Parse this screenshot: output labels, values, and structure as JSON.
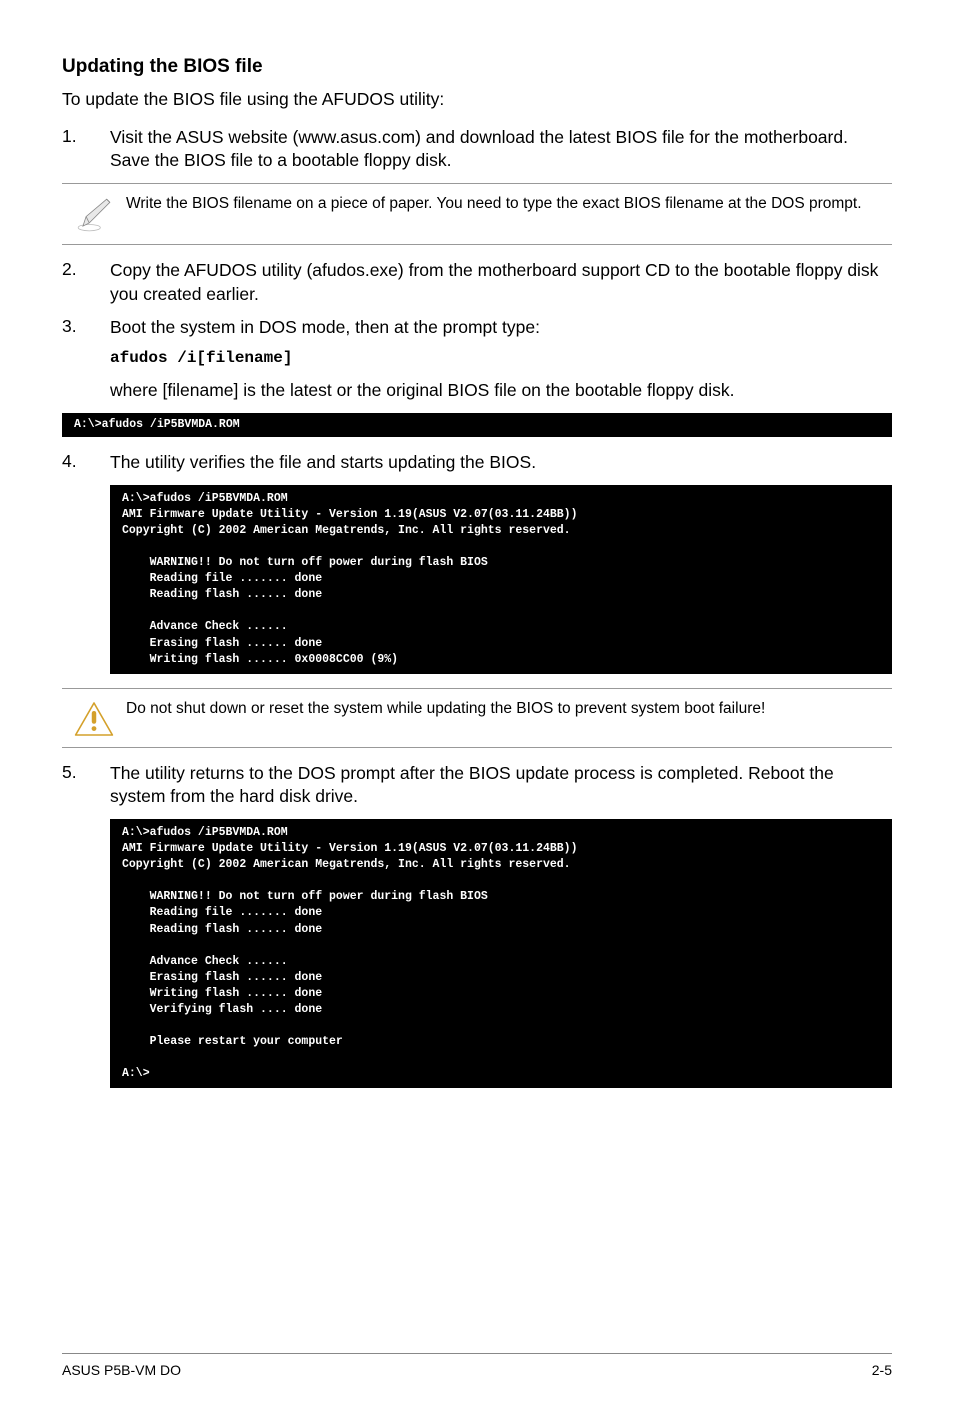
{
  "heading": "Updating the BIOS file",
  "intro": "To update the BIOS file using the AFUDOS utility:",
  "steps": {
    "s1": {
      "num": "1.",
      "text": "Visit the ASUS website (www.asus.com) and download the latest BIOS file for the motherboard. Save the BIOS file to a bootable floppy disk."
    },
    "s2": {
      "num": "2.",
      "text": "Copy the AFUDOS utility (afudos.exe) from the motherboard support CD to the bootable floppy disk you created earlier."
    },
    "s3": {
      "num": "3.",
      "text": "Boot the system in DOS mode, then at the prompt type:",
      "code": "afudos /i[filename]"
    },
    "s3b": "where [filename] is the latest or the original BIOS file on the bootable floppy disk.",
    "s4": {
      "num": "4.",
      "text": "The utility verifies the file and starts updating the BIOS."
    },
    "s5": {
      "num": "5.",
      "text": "The utility returns to the DOS prompt after the BIOS update process is completed. Reboot the system from the hard disk drive."
    }
  },
  "note1": "Write the BIOS filename on a piece of paper. You need to type the exact BIOS filename at the DOS prompt.",
  "note2": "Do not shut down or reset the system while updating the BIOS to prevent system boot failure!",
  "term1": "A:\\>afudos /iP5BVMDA.ROM",
  "term2": "A:\\>afudos /iP5BVMDA.ROM\nAMI Firmware Update Utility - Version 1.19(ASUS V2.07(03.11.24BB))\nCopyright (C) 2002 American Megatrends, Inc. All rights reserved.\n\n    WARNING!! Do not turn off power during flash BIOS\n    Reading file ....... done\n    Reading flash ...... done\n\n    Advance Check ......\n    Erasing flash ...... done\n    Writing flash ...... 0x0008CC00 (9%)",
  "term3": "A:\\>afudos /iP5BVMDA.ROM\nAMI Firmware Update Utility - Version 1.19(ASUS V2.07(03.11.24BB))\nCopyright (C) 2002 American Megatrends, Inc. All rights reserved.\n\n    WARNING!! Do not turn off power during flash BIOS\n    Reading file ....... done\n    Reading flash ...... done\n\n    Advance Check ......\n    Erasing flash ...... done\n    Writing flash ...... done\n    Verifying flash .... done\n\n    Please restart your computer\n\nA:\\>",
  "footer": {
    "left": "ASUS P5B-VM DO",
    "right": "2-5"
  }
}
